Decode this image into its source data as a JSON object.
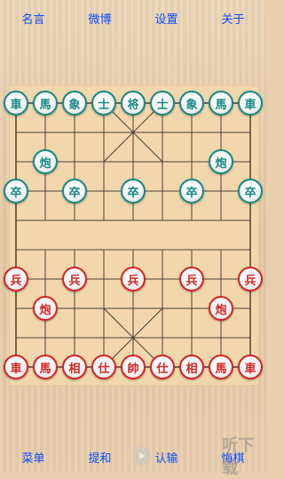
{
  "top_nav": {
    "quotes": "名言",
    "weibo": "微博",
    "settings": "设置",
    "about": "关于"
  },
  "bottom_nav": {
    "menu": "菜单",
    "offer_draw": "提和",
    "resign": "认输",
    "undo": "悔棋"
  },
  "watermark": {
    "text": "听下载"
  },
  "colors": {
    "red_side": "#d42424",
    "green_side": "#148a84",
    "nav_text": "#0a4cff",
    "board_line": "#4a4038"
  },
  "pieces": [
    {
      "label": "車",
      "side": "green",
      "file": 0,
      "rank": 0
    },
    {
      "label": "馬",
      "side": "green",
      "file": 1,
      "rank": 0
    },
    {
      "label": "象",
      "side": "green",
      "file": 2,
      "rank": 0
    },
    {
      "label": "士",
      "side": "green",
      "file": 3,
      "rank": 0
    },
    {
      "label": "将",
      "side": "green",
      "file": 4,
      "rank": 0
    },
    {
      "label": "士",
      "side": "green",
      "file": 5,
      "rank": 0
    },
    {
      "label": "象",
      "side": "green",
      "file": 6,
      "rank": 0
    },
    {
      "label": "馬",
      "side": "green",
      "file": 7,
      "rank": 0
    },
    {
      "label": "車",
      "side": "green",
      "file": 8,
      "rank": 0
    },
    {
      "label": "炮",
      "side": "green",
      "file": 1,
      "rank": 2
    },
    {
      "label": "炮",
      "side": "green",
      "file": 7,
      "rank": 2
    },
    {
      "label": "卒",
      "side": "green",
      "file": 0,
      "rank": 3
    },
    {
      "label": "卒",
      "side": "green",
      "file": 2,
      "rank": 3
    },
    {
      "label": "卒",
      "side": "green",
      "file": 4,
      "rank": 3
    },
    {
      "label": "卒",
      "side": "green",
      "file": 6,
      "rank": 3
    },
    {
      "label": "卒",
      "side": "green",
      "file": 8,
      "rank": 3
    },
    {
      "label": "兵",
      "side": "red",
      "file": 0,
      "rank": 6
    },
    {
      "label": "兵",
      "side": "red",
      "file": 2,
      "rank": 6
    },
    {
      "label": "兵",
      "side": "red",
      "file": 4,
      "rank": 6
    },
    {
      "label": "兵",
      "side": "red",
      "file": 6,
      "rank": 6
    },
    {
      "label": "兵",
      "side": "red",
      "file": 8,
      "rank": 6
    },
    {
      "label": "炮",
      "side": "red",
      "file": 1,
      "rank": 7
    },
    {
      "label": "炮",
      "side": "red",
      "file": 7,
      "rank": 7
    },
    {
      "label": "車",
      "side": "red",
      "file": 0,
      "rank": 9
    },
    {
      "label": "馬",
      "side": "red",
      "file": 1,
      "rank": 9
    },
    {
      "label": "相",
      "side": "red",
      "file": 2,
      "rank": 9
    },
    {
      "label": "仕",
      "side": "red",
      "file": 3,
      "rank": 9
    },
    {
      "label": "帥",
      "side": "red",
      "file": 4,
      "rank": 9
    },
    {
      "label": "仕",
      "side": "red",
      "file": 5,
      "rank": 9
    },
    {
      "label": "相",
      "side": "red",
      "file": 6,
      "rank": 9
    },
    {
      "label": "馬",
      "side": "red",
      "file": 7,
      "rank": 9
    },
    {
      "label": "車",
      "side": "red",
      "file": 8,
      "rank": 9
    }
  ]
}
